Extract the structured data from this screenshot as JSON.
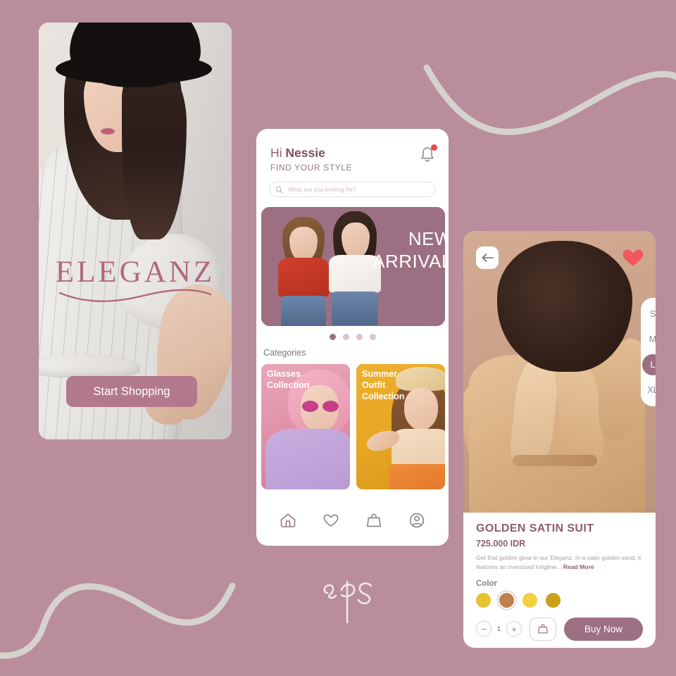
{
  "theme": {
    "background": "#b98d9c",
    "accent": "#9c7082",
    "accent_dark": "#8d5d70",
    "heart_red": "#f0444b",
    "white": "#ffffff"
  },
  "brand": {
    "wordmark": "ELEGANZ",
    "signature": "eps"
  },
  "onboarding": {
    "cta_label": "Start Shopping"
  },
  "home": {
    "greeting_prefix": "Hi ",
    "greeting_name": "Nessie",
    "tagline": "FIND YOUR STYLE",
    "search": {
      "placeholder": "What are you looking for?",
      "value": ""
    },
    "banner": {
      "line1": "NEW",
      "line2": "ARRIVAL"
    },
    "carousel": {
      "dot_count": 4,
      "active_index": 0
    },
    "categories_heading": "Categories",
    "categories": [
      {
        "label": "Glasses\nCollection",
        "color": "#dd8fa6"
      },
      {
        "label": "Summer\nOutfit\nCollection",
        "color": "#e6a522"
      }
    ],
    "nav": [
      {
        "icon": "home-icon",
        "active": true
      },
      {
        "icon": "heart-icon",
        "active": false
      },
      {
        "icon": "bag-icon",
        "active": false
      },
      {
        "icon": "profile-icon",
        "active": false
      }
    ]
  },
  "product": {
    "title": "GOLDEN SATIN SUIT",
    "price": "725.000 IDR",
    "description": "Get that golden glow in our Eleganz. In a satin golden sand, it features an oversized longline...",
    "read_more": "Read More",
    "sizes": [
      {
        "label": "S",
        "selected": false
      },
      {
        "label": "M",
        "selected": false
      },
      {
        "label": "L",
        "selected": true
      },
      {
        "label": "XL",
        "selected": false
      }
    ],
    "color_label": "Color",
    "colors": [
      {
        "hex": "#e8c230",
        "selected": false
      },
      {
        "hex": "#c07f4e",
        "selected": true
      },
      {
        "hex": "#f2d13f",
        "selected": false
      },
      {
        "hex": "#c9a018",
        "selected": false
      }
    ],
    "quantity": "1",
    "decrement_label": "−",
    "increment_label": "+",
    "buy_label": "Buy Now",
    "favorited": true
  }
}
